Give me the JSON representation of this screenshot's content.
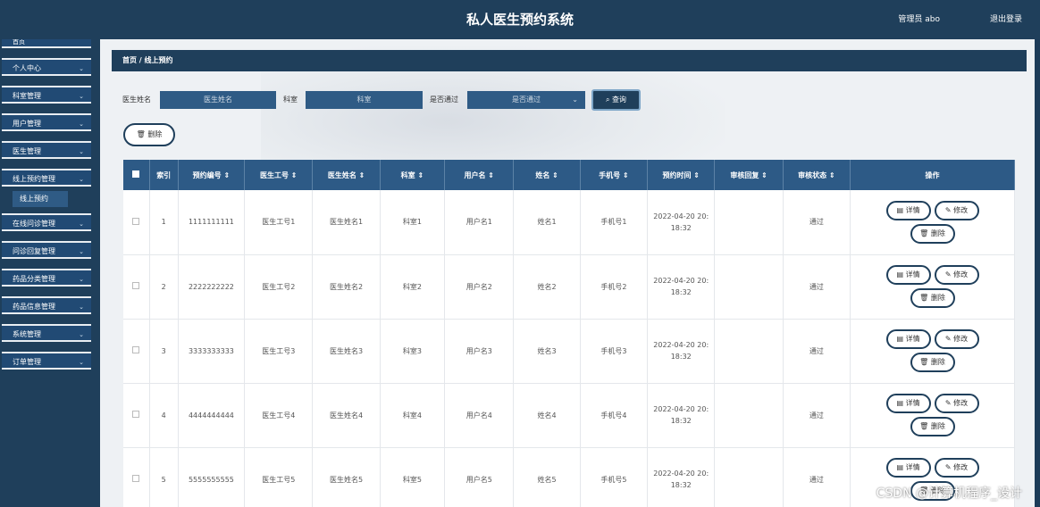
{
  "header": {
    "title": "私人医生预约系统",
    "user": "管理员 abo",
    "logout": "退出登录"
  },
  "sidebar": {
    "top_partial": "首页",
    "items": [
      {
        "label": "个人中心"
      },
      {
        "label": "科室管理"
      },
      {
        "label": "用户管理"
      },
      {
        "label": "医生管理"
      },
      {
        "label": "线上预约管理"
      },
      {
        "label": "在线问诊管理"
      },
      {
        "label": "问诊回复管理"
      },
      {
        "label": "药品分类管理"
      },
      {
        "label": "药品信息管理"
      },
      {
        "label": "系统管理"
      },
      {
        "label": "订单管理"
      }
    ],
    "active_sub": "线上预约",
    "chevron": "⌄"
  },
  "breadcrumb": "首页 / 线上预约",
  "search": {
    "doctor_label": "医生姓名",
    "doctor_placeholder": "医生姓名",
    "dept_label": "科室",
    "dept_placeholder": "科室",
    "pass_label": "是否通过",
    "pass_placeholder": "是否通过",
    "query": "查询"
  },
  "toolbar": {
    "delete": "删除"
  },
  "table": {
    "headers": [
      "索引",
      "预约编号 ⇕",
      "医生工号 ⇕",
      "医生姓名 ⇕",
      "科室 ⇕",
      "用户名 ⇕",
      "姓名 ⇕",
      "手机号 ⇕",
      "预约时间 ⇕",
      "审核回复 ⇕",
      "审核状态 ⇕",
      "操作"
    ],
    "rows": [
      {
        "idx": "1",
        "no": "1111111111",
        "docid": "医生工号1",
        "docname": "医生姓名1",
        "dept": "科室1",
        "user": "用户名1",
        "name": "姓名1",
        "phone": "手机号1",
        "time": "2022-04-20 20:18:32",
        "reply": "",
        "status": "通过"
      },
      {
        "idx": "2",
        "no": "2222222222",
        "docid": "医生工号2",
        "docname": "医生姓名2",
        "dept": "科室2",
        "user": "用户名2",
        "name": "姓名2",
        "phone": "手机号2",
        "time": "2022-04-20 20:18:32",
        "reply": "",
        "status": "通过"
      },
      {
        "idx": "3",
        "no": "3333333333",
        "docid": "医生工号3",
        "docname": "医生姓名3",
        "dept": "科室3",
        "user": "用户名3",
        "name": "姓名3",
        "phone": "手机号3",
        "time": "2022-04-20 20:18:32",
        "reply": "",
        "status": "通过"
      },
      {
        "idx": "4",
        "no": "4444444444",
        "docid": "医生工号4",
        "docname": "医生姓名4",
        "dept": "科室4",
        "user": "用户名4",
        "name": "姓名4",
        "phone": "手机号4",
        "time": "2022-04-20 20:18:32",
        "reply": "",
        "status": "通过"
      },
      {
        "idx": "5",
        "no": "5555555555",
        "docid": "医生工号5",
        "docname": "医生姓名5",
        "dept": "科室5",
        "user": "用户名5",
        "name": "姓名5",
        "phone": "手机号5",
        "time": "2022-04-20 20:18:32",
        "reply": "",
        "status": "通过"
      }
    ],
    "actions": {
      "detail": "详情",
      "edit": "修改",
      "delete": "删除"
    }
  },
  "watermark": "CSDN @计算机程序_设计",
  "colors": {
    "header": "#1f3f5b",
    "table_head": "#2d5a86",
    "input": "#2f5b85"
  }
}
